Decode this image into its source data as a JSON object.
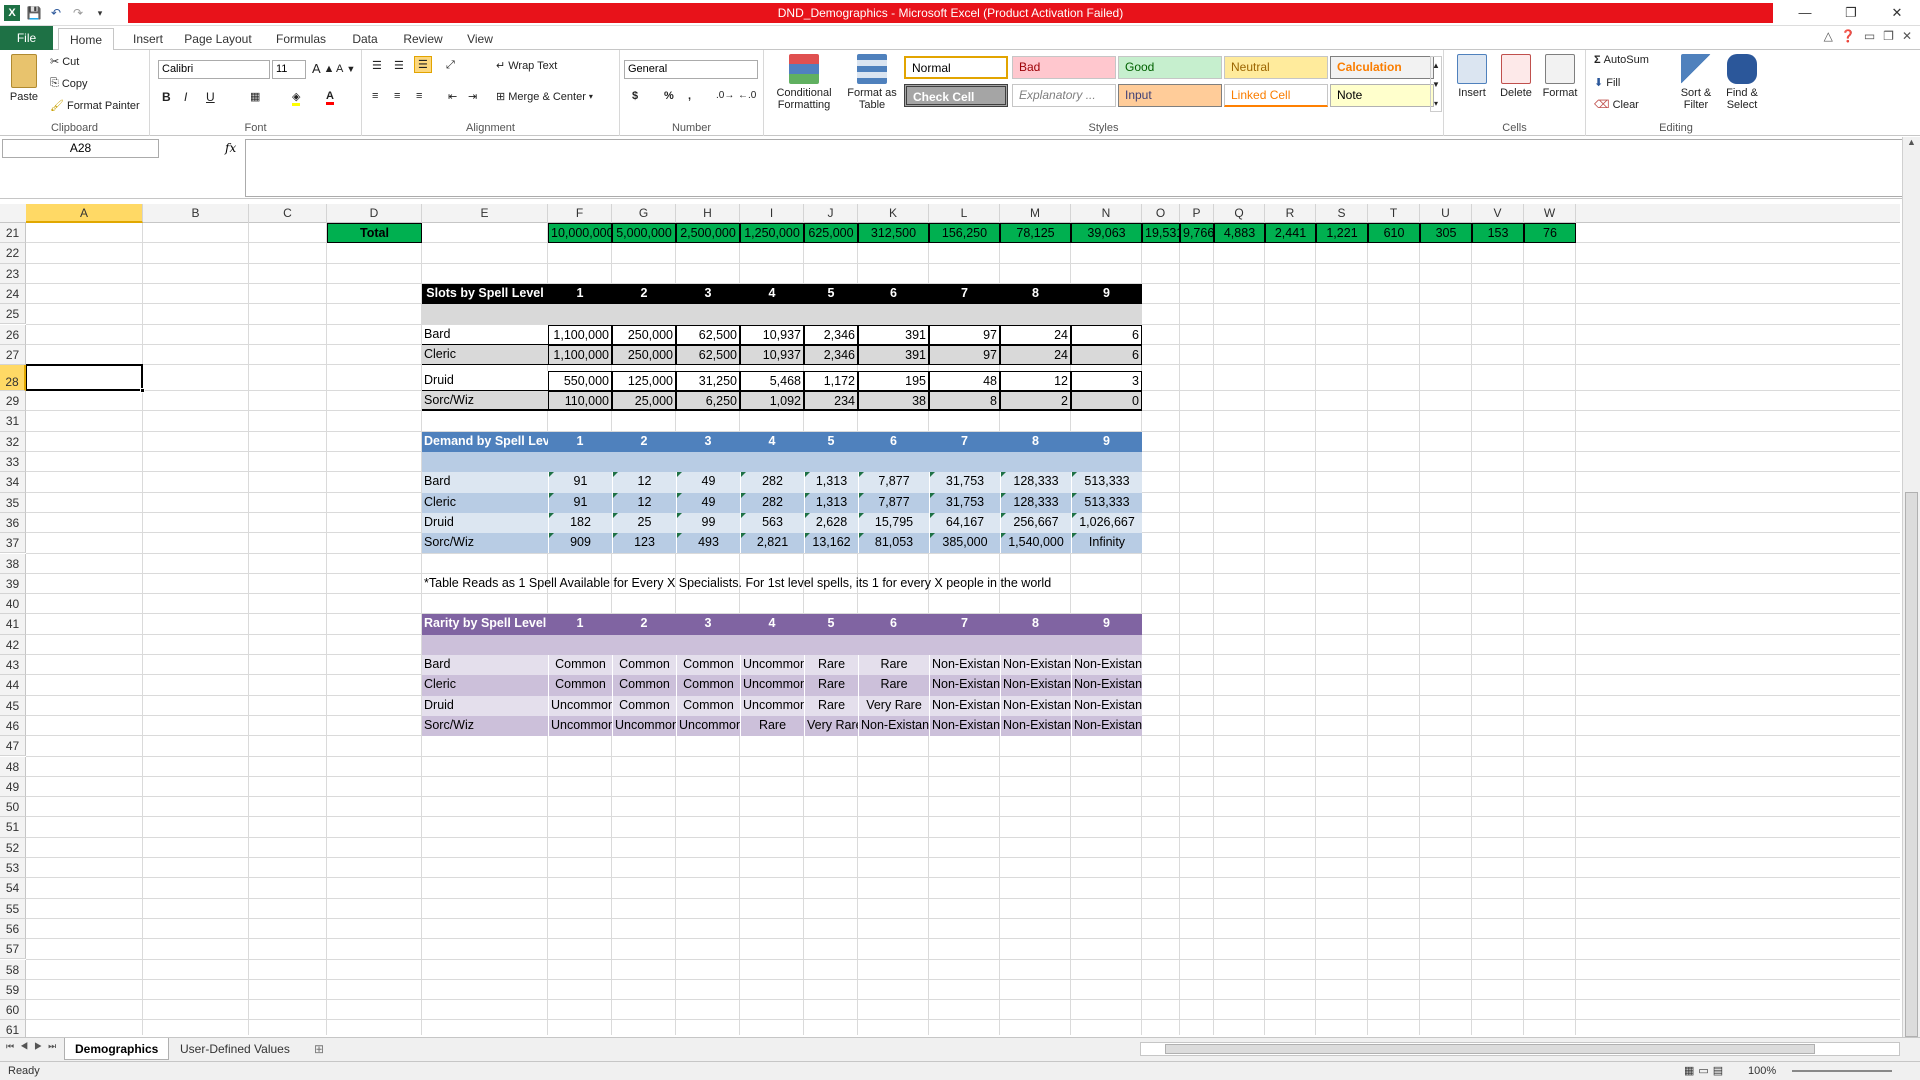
{
  "window": {
    "title": "DND_Demographics  -  Microsoft Excel (Product Activation Failed)",
    "minimize": "—",
    "restore": "❐",
    "close": "✕"
  },
  "tabs": [
    "File",
    "Home",
    "Insert",
    "Page Layout",
    "Formulas",
    "Data",
    "Review",
    "View"
  ],
  "ribbon": {
    "clipboard": {
      "paste": "Paste",
      "cut": "Cut",
      "copy": "Copy",
      "format_painter": "Format Painter",
      "label": "Clipboard"
    },
    "font": {
      "name": "Calibri",
      "size": "11",
      "bold": "B",
      "italic": "I",
      "underline": "U",
      "label": "Font"
    },
    "alignment": {
      "wrap": "Wrap Text",
      "merge": "Merge & Center",
      "label": "Alignment"
    },
    "number": {
      "format": "General",
      "currency": "$",
      "percent": "%",
      "comma": ",",
      "label": "Number"
    },
    "styles": {
      "conditional": "Conditional Formatting",
      "format_table": "Format as Table",
      "normal": "Normal",
      "bad": "Bad",
      "good": "Good",
      "neutral": "Neutral",
      "calculation": "Calculation",
      "check": "Check Cell",
      "explanatory": "Explanatory ...",
      "input": "Input",
      "linked": "Linked Cell",
      "note": "Note",
      "label": "Styles"
    },
    "cells": {
      "insert": "Insert",
      "delete": "Delete",
      "format": "Format",
      "label": "Cells"
    },
    "editing": {
      "autosum": "AutoSum",
      "fill": "Fill",
      "clear": "Clear",
      "sort": "Sort & Filter",
      "find": "Find & Select",
      "label": "Editing"
    }
  },
  "formula_bar": {
    "name_box": "A28",
    "fx": "fx",
    "value": ""
  },
  "columns": [
    "A",
    "B",
    "C",
    "D",
    "E",
    "F",
    "G",
    "H",
    "I",
    "J",
    "K",
    "L",
    "M",
    "N",
    "O",
    "P",
    "Q",
    "R",
    "S",
    "T",
    "U",
    "V",
    "W"
  ],
  "rows": [
    21,
    22,
    23,
    24,
    25,
    26,
    27,
    28,
    29,
    31,
    32,
    33,
    34,
    35,
    36,
    37,
    38,
    39,
    40,
    41,
    42,
    43,
    44,
    45,
    46,
    47,
    48,
    49,
    50,
    51,
    52,
    53,
    54,
    55,
    56,
    57,
    58,
    59,
    60,
    61
  ],
  "total_row": {
    "label": "Total",
    "values": [
      "10,000,000",
      "5,000,000",
      "2,500,000",
      "1,250,000",
      "625,000",
      "312,500",
      "156,250",
      "78,125",
      "39,063",
      "19,531",
      "9,766",
      "4,883",
      "2,441",
      "1,221",
      "610",
      "305",
      "153",
      "76"
    ]
  },
  "slots_table": {
    "title": "Slots by Spell Level",
    "levels": [
      "1",
      "2",
      "3",
      "4",
      "5",
      "6",
      "7",
      "8",
      "9"
    ],
    "rows": [
      {
        "name": "Bard",
        "values": [
          "1,100,000",
          "250,000",
          "62,500",
          "10,937",
          "2,346",
          "391",
          "97",
          "24",
          "6"
        ]
      },
      {
        "name": "Cleric",
        "values": [
          "1,100,000",
          "250,000",
          "62,500",
          "10,937",
          "2,346",
          "391",
          "97",
          "24",
          "6"
        ]
      },
      {
        "name": "Druid",
        "values": [
          "550,000",
          "125,000",
          "31,250",
          "5,468",
          "1,172",
          "195",
          "48",
          "12",
          "3"
        ]
      },
      {
        "name": "Sorc/Wiz",
        "values": [
          "110,000",
          "25,000",
          "6,250",
          "1,092",
          "234",
          "38",
          "8",
          "2",
          "0"
        ]
      }
    ]
  },
  "demand_table": {
    "title": "Demand by Spell Level*",
    "levels": [
      "1",
      "2",
      "3",
      "4",
      "5",
      "6",
      "7",
      "8",
      "9"
    ],
    "rows": [
      {
        "name": "Bard",
        "values": [
          "91",
          "12",
          "49",
          "282",
          "1,313",
          "7,877",
          "31,753",
          "128,333",
          "513,333"
        ]
      },
      {
        "name": "Cleric",
        "values": [
          "91",
          "12",
          "49",
          "282",
          "1,313",
          "7,877",
          "31,753",
          "128,333",
          "513,333"
        ]
      },
      {
        "name": "Druid",
        "values": [
          "182",
          "25",
          "99",
          "563",
          "2,628",
          "15,795",
          "64,167",
          "256,667",
          "1,026,667"
        ]
      },
      {
        "name": "Sorc/Wiz",
        "values": [
          "909",
          "123",
          "493",
          "2,821",
          "13,162",
          "81,053",
          "385,000",
          "1,540,000",
          "Infinity"
        ]
      }
    ],
    "note": "*Table Reads as 1 Spell Available for Every X Specialists. For 1st level spells, its 1 for every X people in the world"
  },
  "rarity_table": {
    "title": "Rarity by Spell Level",
    "levels": [
      "1",
      "2",
      "3",
      "4",
      "5",
      "6",
      "7",
      "8",
      "9"
    ],
    "rows": [
      {
        "name": "Bard",
        "values": [
          "Common",
          "Common",
          "Common",
          "Uncommon",
          "Rare",
          "Rare",
          "Non-Existant",
          "Non-Existant",
          "Non-Existant"
        ]
      },
      {
        "name": "Cleric",
        "values": [
          "Common",
          "Common",
          "Common",
          "Uncommon",
          "Rare",
          "Rare",
          "Non-Existant",
          "Non-Existant",
          "Non-Existant"
        ]
      },
      {
        "name": "Druid",
        "values": [
          "Uncommon",
          "Common",
          "Common",
          "Uncommon",
          "Rare",
          "Very Rare",
          "Non-Existant",
          "Non-Existant",
          "Non-Existant"
        ]
      },
      {
        "name": "Sorc/Wiz",
        "values": [
          "Uncommon",
          "Uncommon",
          "Uncommon",
          "Rare",
          "Very Rare",
          "Non-Existant",
          "Non-Existant",
          "Non-Existant",
          "Non-Existant"
        ]
      }
    ]
  },
  "sheets": [
    "Demographics",
    "User-Defined Values"
  ],
  "status": {
    "ready": "Ready",
    "zoom": "100%"
  },
  "colors": {
    "excel_green": "#1e7145",
    "title_red": "#e8121a",
    "total_green": "#00b050",
    "demand_blue": "#4f81bd",
    "rarity_purple": "#8064a2"
  }
}
